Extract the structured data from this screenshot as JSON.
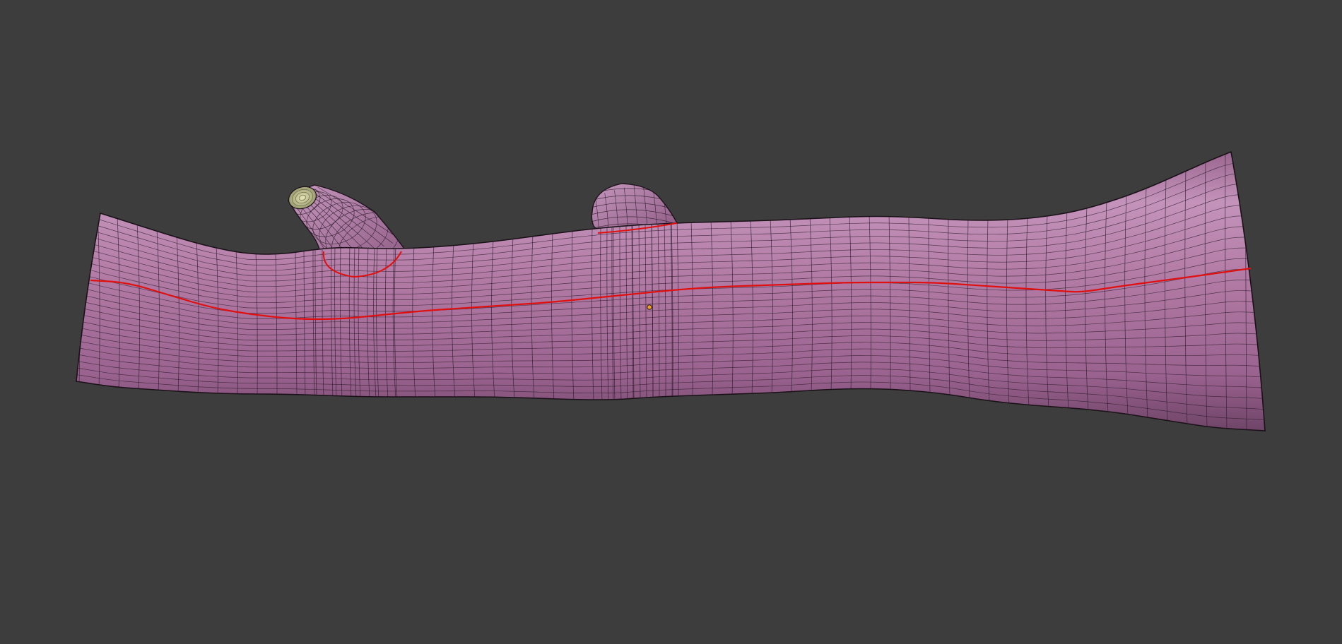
{
  "viewport": {
    "background_color": "#3d3d3d"
  },
  "mesh": {
    "object": "tree-branch-log",
    "display_mode": "edit-mode-wireframe-overlay",
    "colors": {
      "surface": "#b27ba5",
      "surface_shadow": "#7a4d72",
      "surface_highlight": "#cfa0c7",
      "wire": "#2a1a28",
      "seam": "#e01010",
      "cut_face": "#c6c79a",
      "origin": "#f0a020"
    },
    "features": [
      "main-trunk",
      "branch-stub-left",
      "branch-stub-right",
      "uv-seam-line",
      "object-origin"
    ]
  }
}
